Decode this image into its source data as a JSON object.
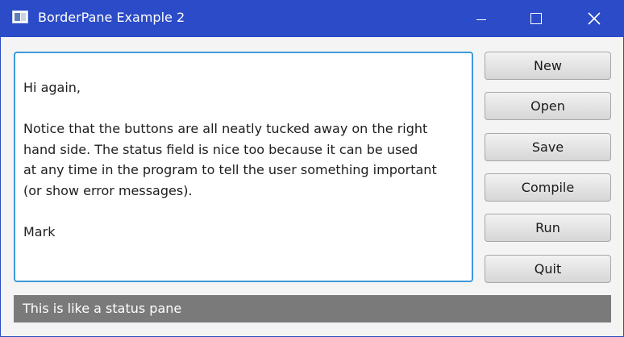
{
  "window": {
    "title": "BorderPane Example 2",
    "accent_color": "#2b4bc8"
  },
  "title_bar_controls": [
    {
      "name": "minimize",
      "icon": "minimize-icon"
    },
    {
      "name": "maximize",
      "icon": "maximize-icon"
    },
    {
      "name": "close",
      "icon": "close-icon",
      "glyph": "✕"
    }
  ],
  "editor": {
    "text": "Hi again,\n\nNotice that the buttons are all neatly tucked away on the right\nhand side.   The status field is nice too because it can be used\nat any time in the program to tell the user something important\n(or show error messages).\n\nMark",
    "focus_border_color": "#3d9ad8"
  },
  "buttons": {
    "new": "New",
    "open": "Open",
    "save": "Save",
    "compile": "Compile",
    "run": "Run",
    "quit": "Quit"
  },
  "status": {
    "text": "This is like a status pane",
    "background_color": "#7a7a7a"
  }
}
